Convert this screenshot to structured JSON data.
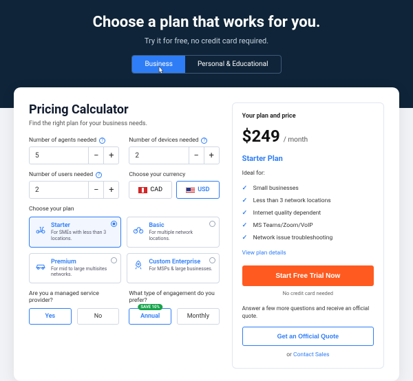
{
  "hero": {
    "title": "Choose a plan that works for you.",
    "subtitle": "Try it for free, no credit card required.",
    "tab_business": "Business",
    "tab_personal": "Personal & Educational"
  },
  "calc": {
    "title": "Pricing Calculator",
    "desc": "Find the right plan for your business needs.",
    "agents_label": "Number of agents needed",
    "agents_value": "5",
    "devices_label": "Number of devices needed",
    "devices_value": "2",
    "users_label": "Number of users needed",
    "users_value": "2",
    "currency_label": "Choose your currency",
    "currency_cad": "CAD",
    "currency_usd": "USD",
    "plan_label": "Choose your plan",
    "plans": [
      {
        "name": "Starter",
        "desc": "For SMEs with less than 3 locations."
      },
      {
        "name": "Basic",
        "desc": "For multiple network locations."
      },
      {
        "name": "Premium",
        "desc": "For mid to large multisites networks."
      },
      {
        "name": "Custom Enterprise",
        "desc": "For MSPs & large businesses."
      }
    ],
    "msp_label": "Are you a managed service provider?",
    "msp_yes": "Yes",
    "msp_no": "No",
    "engage_label": "What type of engagement do you prefer?",
    "engage_annual": "Annual",
    "engage_badge": "SAVE 10%",
    "engage_monthly": "Monthly"
  },
  "summary": {
    "header": "Your plan and price",
    "amount": "$249",
    "period": "/ month",
    "plan_name": "Starter Plan",
    "ideal": "Ideal for:",
    "features": [
      "Small businesses",
      "Less than 3 network locations",
      "Internet quality dependent",
      "MS Teams/Zoom/VoIP",
      "Network issue troubleshooting"
    ],
    "view_details": "View plan details",
    "cta": "Start Free Trial Now",
    "no_card": "No credit card needed",
    "more": "Answer a few more questions and receive an official quote.",
    "quote_btn": "Get an Official Quote",
    "or_prefix": "or ",
    "contact": "Contact Sales"
  }
}
